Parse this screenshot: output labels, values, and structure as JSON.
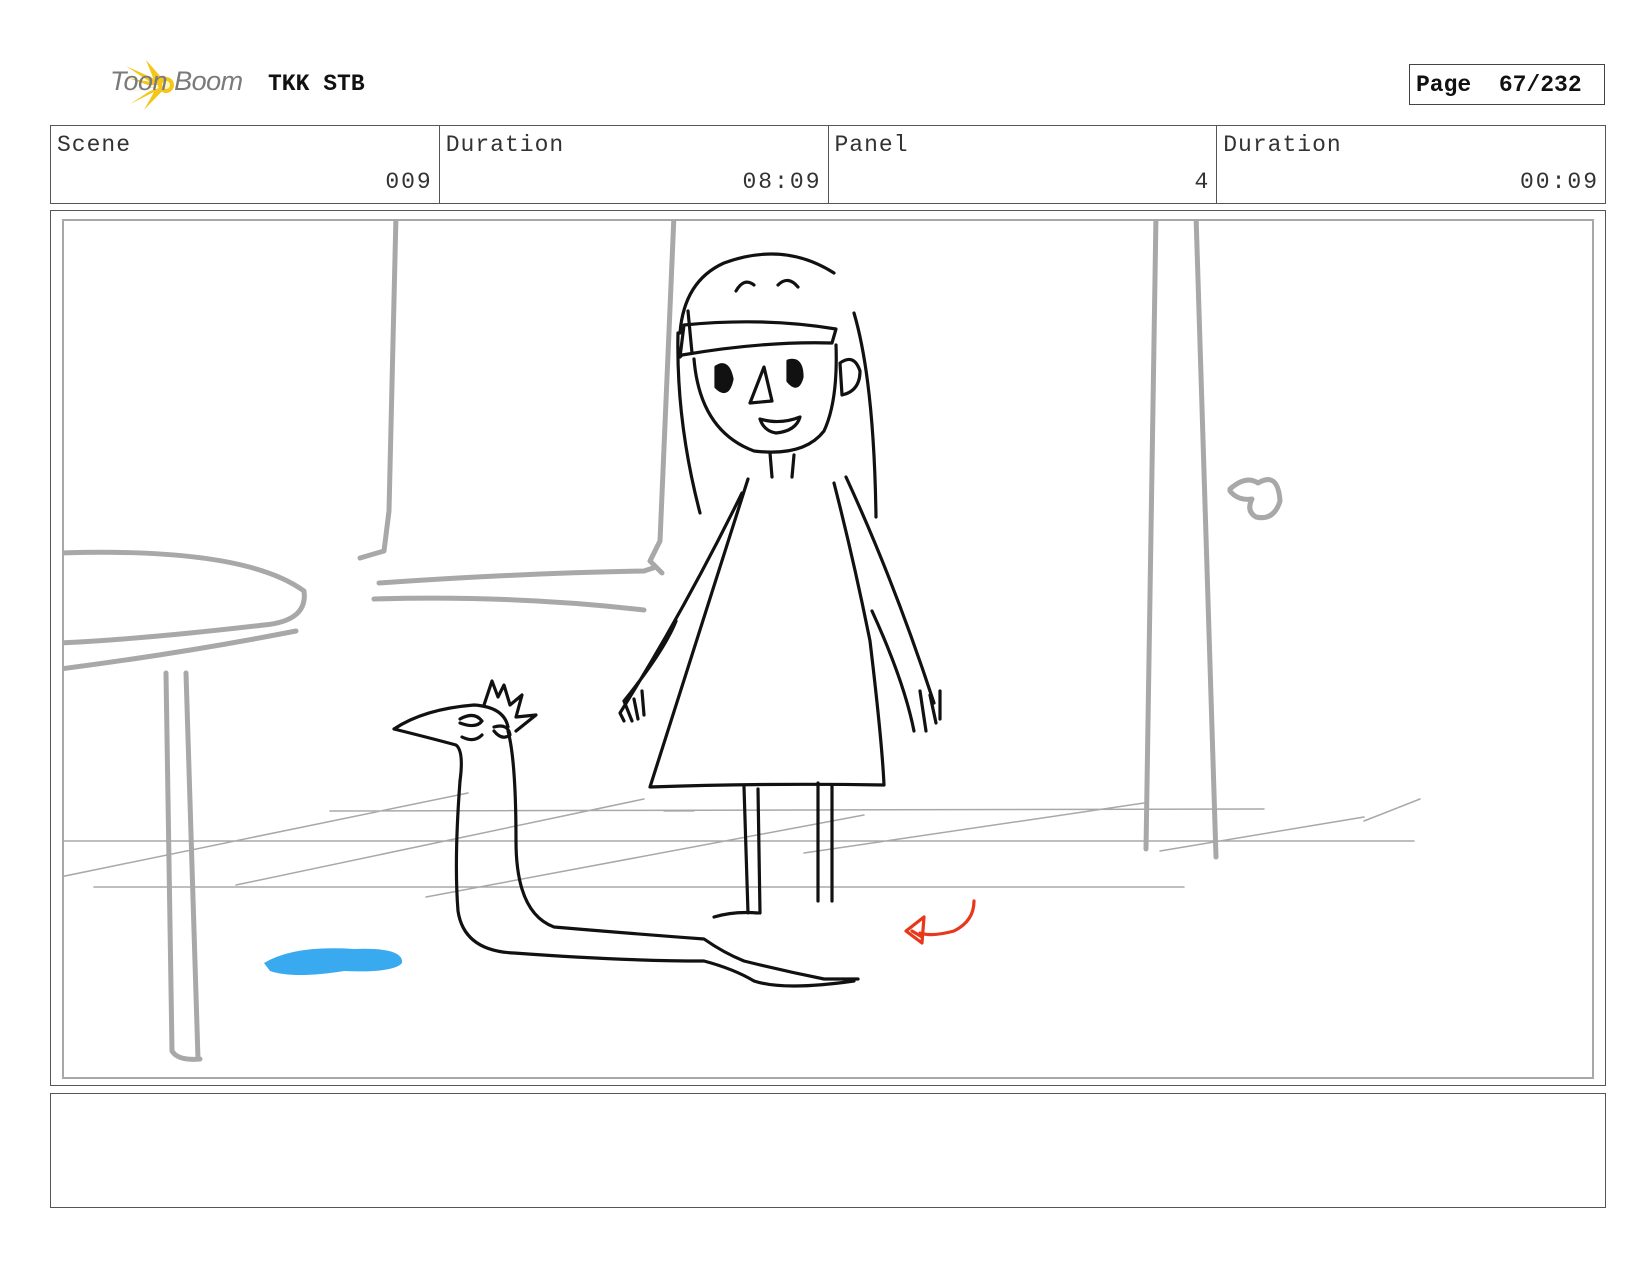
{
  "header": {
    "logo_text": "Toon Boom",
    "project_title": "TKK STB",
    "page_label": "Page",
    "page_number": "67/232"
  },
  "info": {
    "scene_label": "Scene",
    "scene_value": "009",
    "scene_duration_label": "Duration",
    "scene_duration_value": "08:09",
    "panel_label": "Panel",
    "panel_value": "4",
    "panel_duration_label": "Duration",
    "panel_duration_value": "00:09"
  },
  "notes": {
    "text": ""
  },
  "colors": {
    "logo_accent": "#f5c518",
    "sketch_line": "#111111",
    "background_line": "#a8a8a8",
    "puddle": "#3aaaf0",
    "action_arrow": "#e8381c"
  }
}
